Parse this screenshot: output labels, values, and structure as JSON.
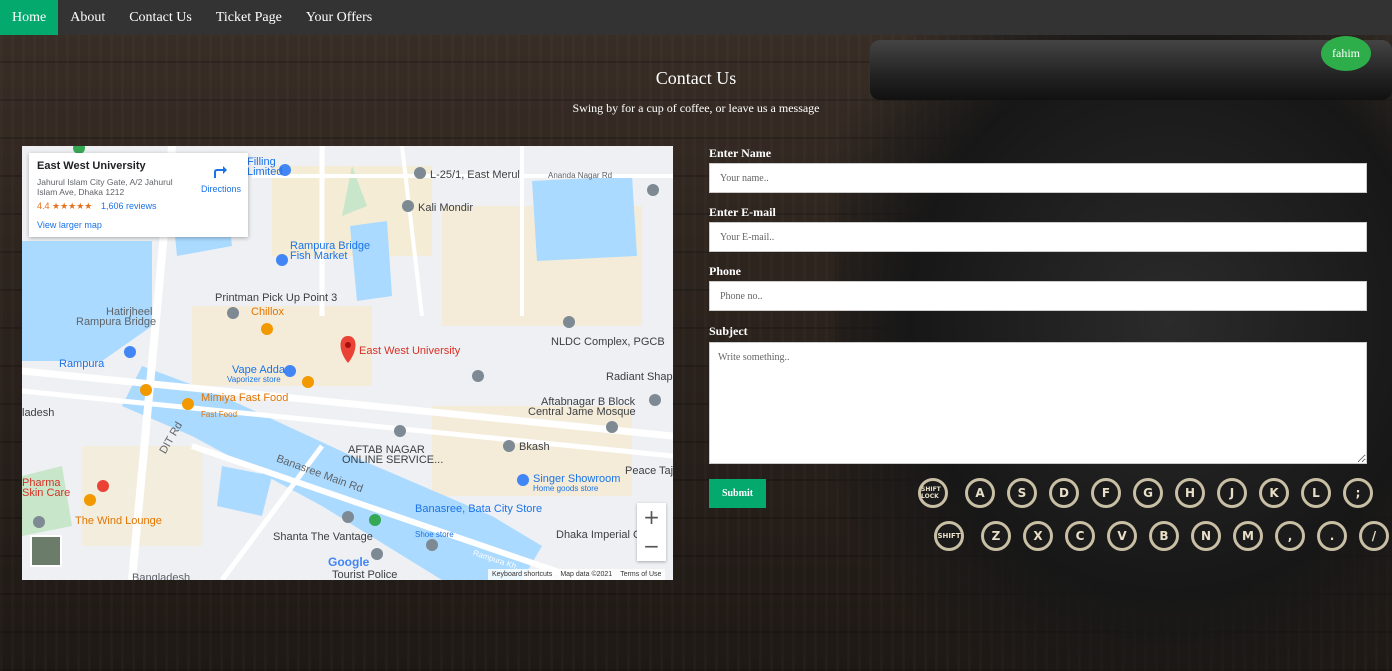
{
  "nav": {
    "items": [
      {
        "label": "Home",
        "active": true
      },
      {
        "label": "About",
        "active": false
      },
      {
        "label": "Contact Us",
        "active": false
      },
      {
        "label": "Ticket Page",
        "active": false
      },
      {
        "label": "Your Offers",
        "active": false
      }
    ],
    "user": "fahim"
  },
  "header": {
    "title": "Contact Us",
    "subtitle": "Swing by for a cup of coffee, or leave us a message"
  },
  "map": {
    "place_name": "East West University",
    "address": "Jahurul Islam City Gate, A/2 Jahurul Islam Ave, Dhaka 1212",
    "rating": "4.4 ★★★★★",
    "reviews": "1,606 reviews",
    "view_larger": "View larger map",
    "directions": "Directions",
    "labels": {
      "filling": "Filling",
      "limited": "Limited",
      "l25": "L-25/1, East Merul",
      "ananda": "Ananda Nagar Rd",
      "kali": "Kali Mondir",
      "fish1": "Rampura Bridge",
      "fish2": "Fish Market",
      "printman": "Printman Pick Up Point 3",
      "chillox": "Chillox",
      "hatirjheel1": "Hatirjheel",
      "hatirjheel2": "Rampura Bridge",
      "ewu": "East West University",
      "nldc": "NLDC Complex, PGCB",
      "rampura": "Rampura",
      "vape1": "Vape Adda",
      "vape2": "Vaporizer store",
      "radiant": "Radiant Shapla",
      "aftab1": "Aftabnagar B Block",
      "aftab2": "Central Jame Mosque",
      "mimiya1": "Mimiya Fast Food",
      "mimiya2": "Fast Food",
      "ladesh": "ladesh",
      "aftabnagar1": "AFTAB NAGAR",
      "aftabnagar2": "ONLINE SERVICE...",
      "bkash": "Bkash",
      "peace": "Peace Taj",
      "singer1": "Singer Showroom",
      "singer2": "Home goods store",
      "banasree_road": "Banasree Main Rd",
      "pharma1": "Pharma",
      "pharma2": "Skin Care",
      "windlounge": "The Wind Lounge",
      "batacity1": "Banasree, Bata City Store",
      "batacity2": "Shoe store",
      "dhaka": "Dhaka Imperial Co",
      "shanta": "Shanta The Vantage",
      "tourist": "Tourist Police",
      "dit": "DIT Rd",
      "bangladesh": "Bangladesh",
      "rampura_rd": "Rampura Kh..."
    },
    "google": "Google",
    "attribution": [
      "Keyboard shortcuts",
      "Map data ©2021",
      "Terms of Use"
    ]
  },
  "form": {
    "name_label": "Enter Name",
    "name_placeholder": "Your name..",
    "email_label": "Enter E-mail",
    "email_placeholder": "Your E-mail..",
    "phone_label": "Phone",
    "phone_placeholder": "Phone no..",
    "subject_label": "Subject",
    "subject_placeholder": "Write something..",
    "submit_label": "Submit"
  },
  "keyboard": {
    "row1": [
      "SHIFT LOCK",
      "A",
      "S",
      "D",
      "F",
      "G",
      "H",
      "J",
      "K",
      "L",
      ";"
    ],
    "row2": [
      "SHIFT",
      "Z",
      "X",
      "C",
      "V",
      "B",
      "N",
      "M",
      ",",
      ".",
      "/"
    ]
  },
  "colors": {
    "nav_bg": "#333333",
    "accent": "#04aa6d",
    "user_badge": "#2eae4a"
  }
}
